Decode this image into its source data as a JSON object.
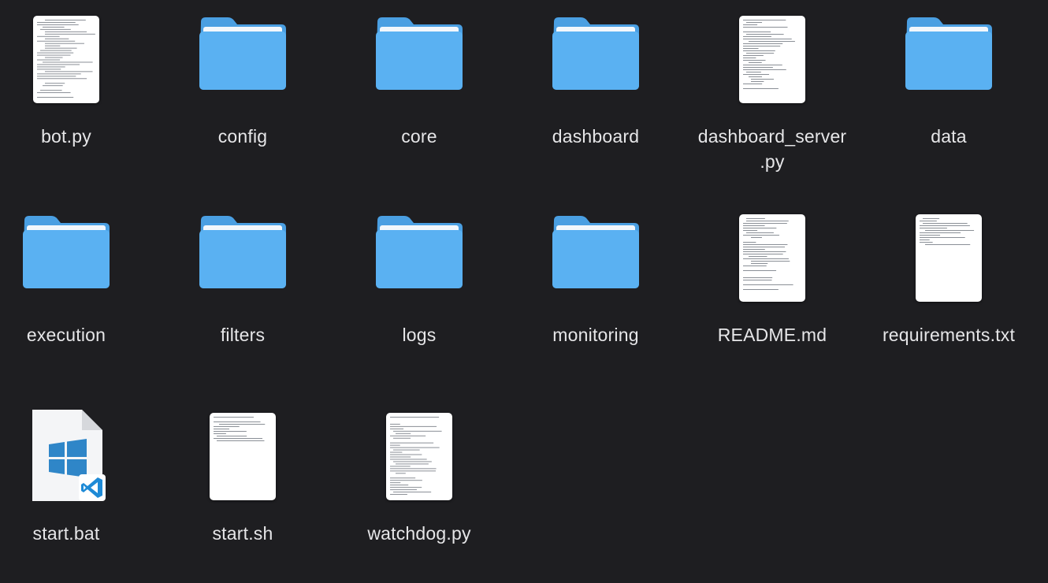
{
  "window": {
    "view": "icon-grid"
  },
  "colors": {
    "background": "#1e1e21",
    "folder_front": "#5ab1f2",
    "folder_back": "#4a9fe2",
    "folder_sheet": "#f2f7fc",
    "label": "#e6e6e8"
  },
  "items": [
    {
      "name": "bot.py",
      "kind": "python-file",
      "icon": "document-thumbnail-icon"
    },
    {
      "name": "config",
      "kind": "folder",
      "icon": "folder-icon"
    },
    {
      "name": "core",
      "kind": "folder",
      "icon": "folder-icon"
    },
    {
      "name": "dashboard",
      "kind": "folder",
      "icon": "folder-icon"
    },
    {
      "name": "dashboard_server\n.py",
      "kind": "python-file",
      "icon": "document-thumbnail-icon"
    },
    {
      "name": "data",
      "kind": "folder",
      "icon": "folder-icon"
    },
    {
      "name": "execution",
      "kind": "folder",
      "icon": "folder-icon"
    },
    {
      "name": "filters",
      "kind": "folder",
      "icon": "folder-icon"
    },
    {
      "name": "logs",
      "kind": "folder",
      "icon": "folder-icon"
    },
    {
      "name": "monitoring",
      "kind": "folder",
      "icon": "folder-icon"
    },
    {
      "name": "README.md",
      "kind": "markdown-file",
      "icon": "document-thumbnail-icon"
    },
    {
      "name": "requirements.txt",
      "kind": "text-file",
      "icon": "document-thumbnail-icon"
    },
    {
      "name": "start.bat",
      "kind": "batch-file",
      "icon": "windows-batch-file-icon"
    },
    {
      "name": "start.sh",
      "kind": "shell-file",
      "icon": "document-thumbnail-icon"
    },
    {
      "name": "watchdog.py",
      "kind": "python-file",
      "icon": "document-thumbnail-icon"
    }
  ]
}
